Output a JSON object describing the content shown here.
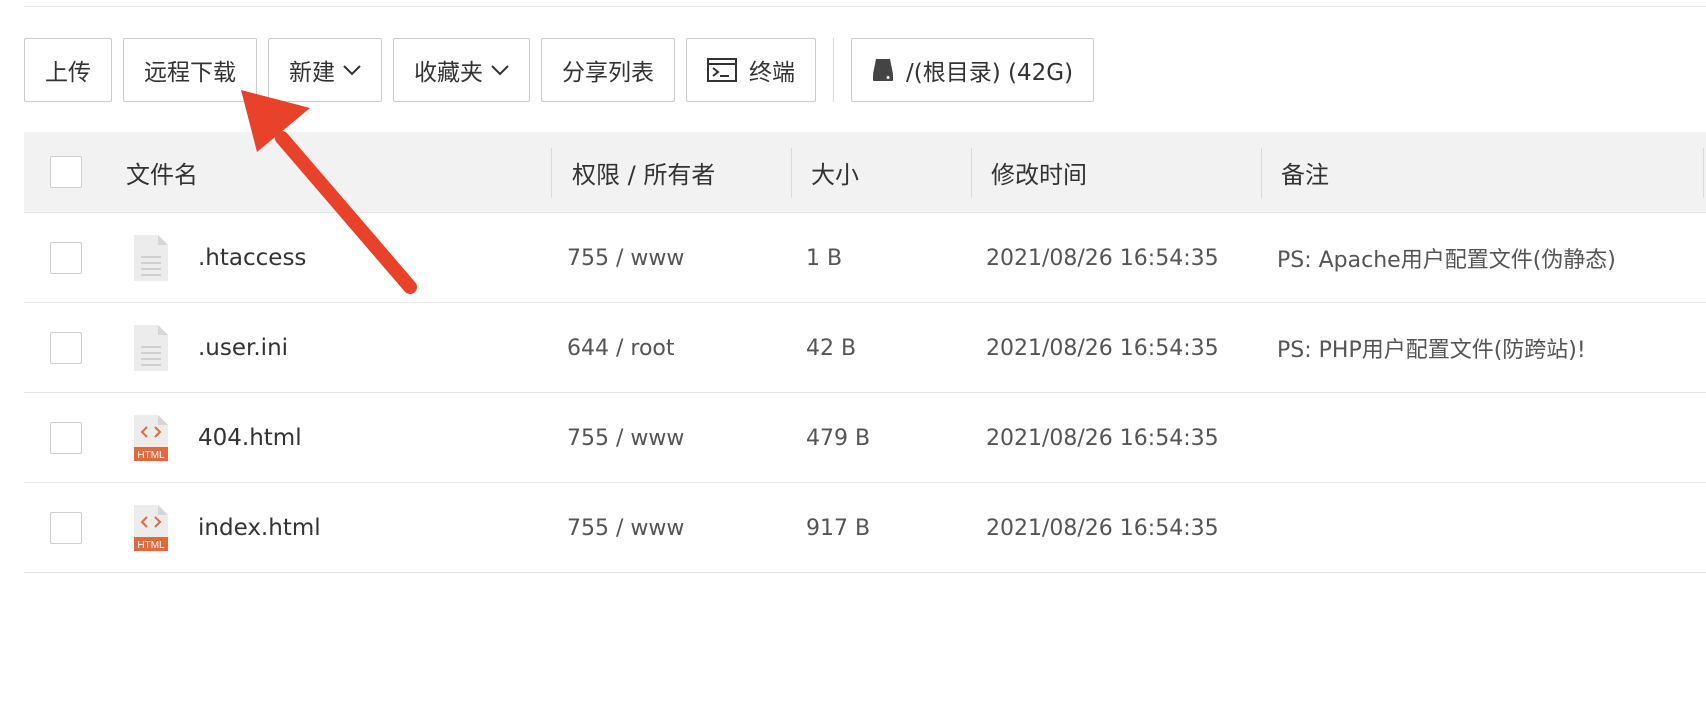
{
  "toolbar": {
    "upload": "上传",
    "remote_download": "远程下载",
    "new": "新建",
    "favorites": "收藏夹",
    "share_list": "分享列表",
    "terminal": "终端",
    "disk": "/(根目录) (42G)"
  },
  "table": {
    "headers": {
      "name": "文件名",
      "perm": "权限 / 所有者",
      "size": "大小",
      "mtime": "修改时间",
      "note": "备注"
    },
    "rows": [
      {
        "name": ".htaccess",
        "perm": "755 / www",
        "size": "1 B",
        "mtime": "2021/08/26 16:54:35",
        "note": "PS: Apache用户配置文件(伪静态)",
        "icon": "generic-file-icon"
      },
      {
        "name": ".user.ini",
        "perm": "644 / root",
        "size": "42 B",
        "mtime": "2021/08/26 16:54:35",
        "note": "PS: PHP用户配置文件(防跨站)!",
        "icon": "generic-file-icon"
      },
      {
        "name": "404.html",
        "perm": "755 / www",
        "size": "479 B",
        "mtime": "2021/08/26 16:54:35",
        "note": "",
        "icon": "html-file-icon"
      },
      {
        "name": "index.html",
        "perm": "755 / www",
        "size": "917 B",
        "mtime": "2021/08/26 16:54:35",
        "note": "",
        "icon": "html-file-icon"
      }
    ]
  },
  "html_badge": "HTML",
  "colors": {
    "arrow": "#e8432a",
    "html_icon": "#e06b3a",
    "header_bg": "#f2f2f2"
  }
}
